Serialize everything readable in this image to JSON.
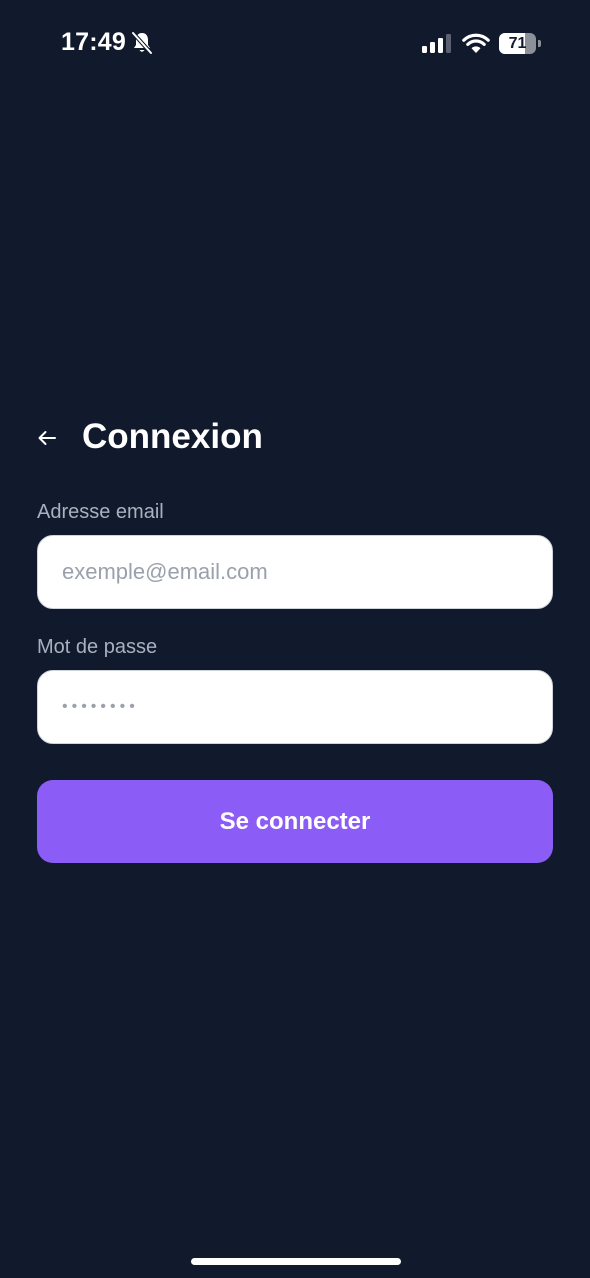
{
  "status_bar": {
    "time": "17:49",
    "battery_level": "71",
    "battery_fraction": 0.71,
    "icons": [
      "bell-slash-icon",
      "cellular-signal-icon",
      "wifi-icon",
      "battery-icon"
    ]
  },
  "header": {
    "back_icon": "arrow-left-icon",
    "title": "Connexion"
  },
  "form": {
    "email_label": "Adresse email",
    "email_placeholder": "exemple@email.com",
    "email_value": "",
    "password_label": "Mot de passe",
    "password_value": "••••••••",
    "submit_label": "Se connecter"
  },
  "colors": {
    "background": "#111a2c",
    "accent": "#8b5cf6",
    "label": "#a9b0be",
    "input_background": "#ffffff"
  }
}
